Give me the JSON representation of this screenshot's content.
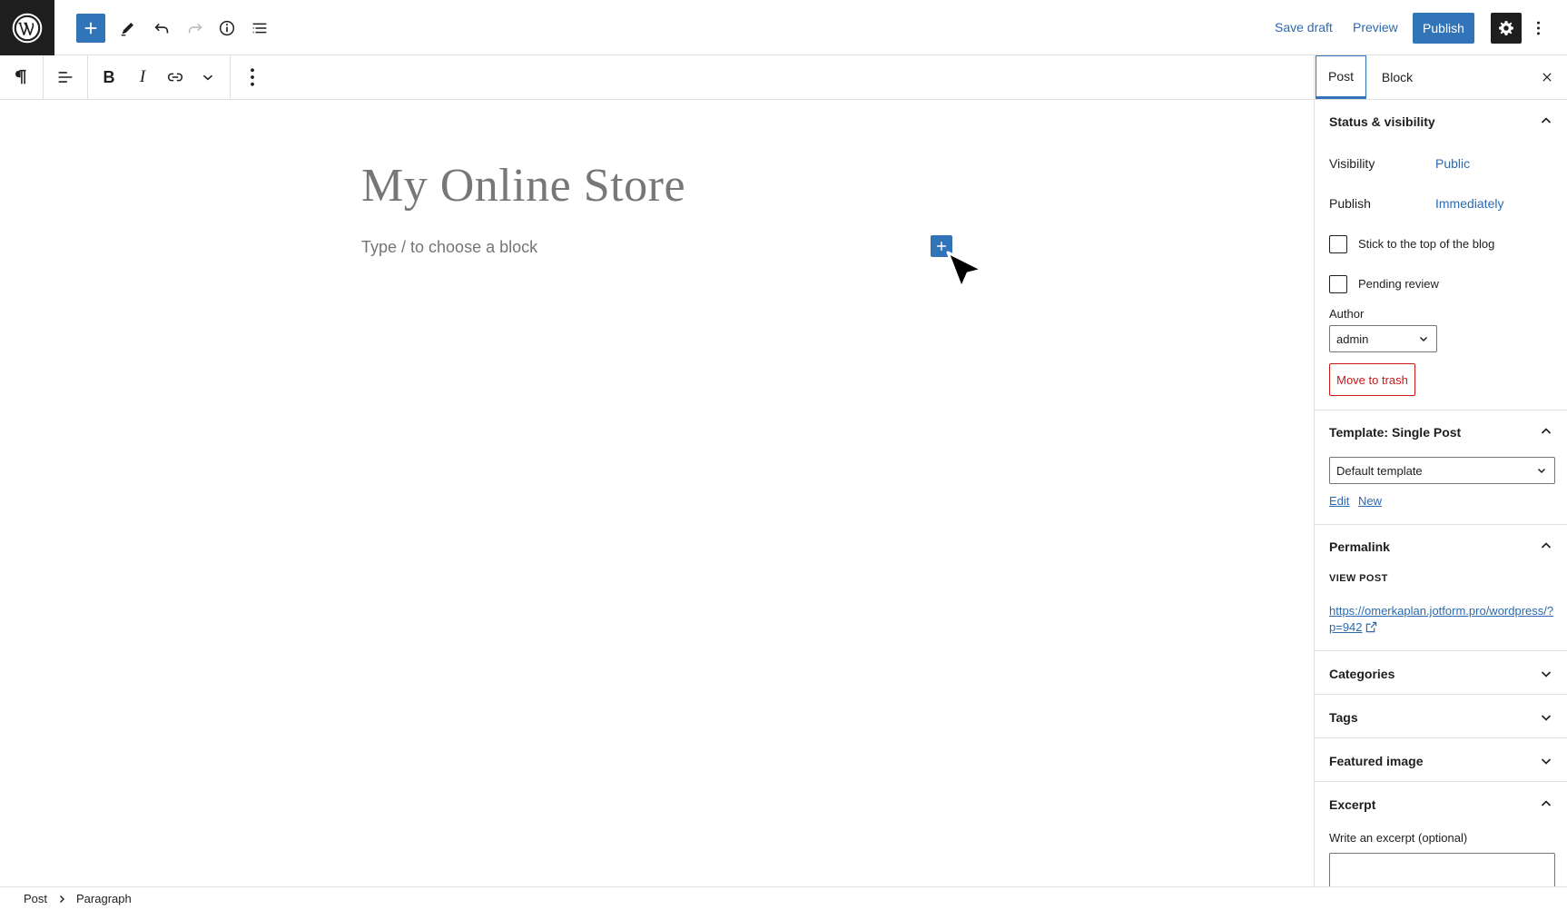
{
  "header": {
    "save_draft": "Save draft",
    "preview": "Preview",
    "publish": "Publish"
  },
  "icons": {
    "logo": "wordpress-logo-icon",
    "add": "plus-icon",
    "tools": "pencil-icon",
    "undo": "undo-icon",
    "redo": "redo-icon",
    "details": "info-icon",
    "outline": "list-view-icon",
    "settings": "gear-icon",
    "options": "vertical-ellipsis-icon"
  },
  "colors": {
    "accent": "#3274b8",
    "link": "#2b6ab0",
    "danger": "#cc1818",
    "dark": "#1e1e1e"
  },
  "editor": {
    "title": "My Online Store",
    "placeholder": "Type / to choose a block"
  },
  "sidebar": {
    "tabs": [
      "Post",
      "Block"
    ],
    "status": {
      "heading": "Status & visibility",
      "visibility_label": "Visibility",
      "visibility_value": "Public",
      "publish_label": "Publish",
      "publish_value": "Immediately",
      "sticky_label": "Stick to the top of the blog",
      "pending_label": "Pending review",
      "author_label": "Author",
      "author_value": "admin",
      "trash": "Move to trash"
    },
    "template": {
      "heading": "Template: Single Post",
      "value": "Default template",
      "edit": "Edit",
      "new": "New"
    },
    "permalink": {
      "heading": "Permalink",
      "view_post": "VIEW POST",
      "url": "https://omerkaplan.jotform.pro/wordpress/?p=942"
    },
    "categories": "Categories",
    "tags": "Tags",
    "featured_image": "Featured image",
    "excerpt": {
      "heading": "Excerpt",
      "label": "Write an excerpt (optional)"
    }
  },
  "breadcrumb": {
    "items": [
      "Post",
      "Paragraph"
    ]
  }
}
